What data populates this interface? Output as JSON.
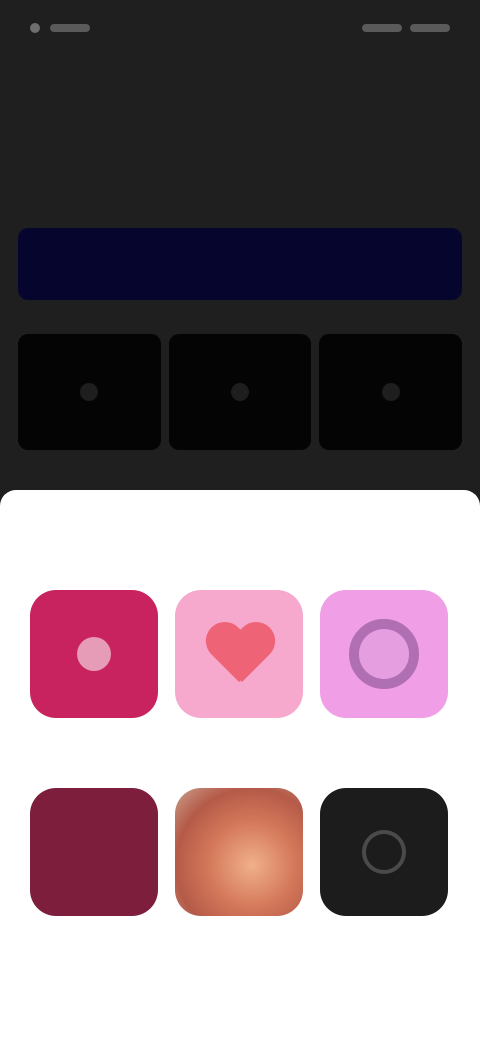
{
  "status_bar": {
    "time": "",
    "right_text": ""
  },
  "header": {
    "title": "",
    "action": ""
  },
  "banner": {
    "text": ""
  },
  "dark_tiles": [
    {
      "icon": "plus-icon"
    },
    {
      "icon": "plus-icon"
    },
    {
      "icon": "plus-icon"
    }
  ],
  "sheet": {
    "title": "",
    "apps": [
      {
        "label": "",
        "bg": "#c8235f",
        "icon": "app-icon-1"
      },
      {
        "label": "",
        "bg": "#f6a9cd",
        "icon": "heart-icon"
      },
      {
        "label": "",
        "bg": "#f09ee6",
        "icon": "ring-icon"
      },
      {
        "label": "",
        "bg": "#7e1e3d",
        "icon": "app-icon-4"
      },
      {
        "label": "",
        "bg": "#cf8b72",
        "icon": "photo-icon"
      },
      {
        "label": "",
        "bg": "#1c1c1c",
        "icon": "dial-icon"
      }
    ]
  },
  "colors": {
    "background": "#1f1f1f",
    "banner": "#05052e",
    "sheet": "#ffffff"
  }
}
